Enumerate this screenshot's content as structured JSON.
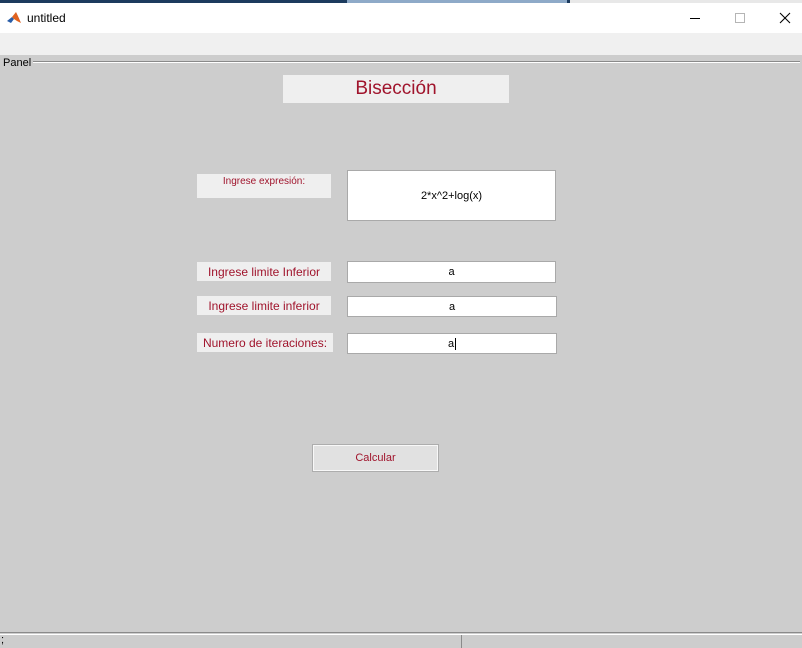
{
  "window": {
    "title": "untitled",
    "icon": "matlab-logo-icon",
    "controls": [
      "minimize-icon",
      "maximize-icon",
      "close-icon"
    ]
  },
  "panel": {
    "label": "Panel"
  },
  "form": {
    "heading": "Bisección",
    "expression_label": "Ingrese expresión:",
    "expression_value": "2*x^2+log(x)",
    "lower_label": "Ingrese limite Inferior",
    "lower_value": "a",
    "upper_label": "Ingrese limite inferior",
    "upper_value": "a",
    "iterations_label": "Numero de iteraciones:",
    "iterations_value": "a",
    "calculate_label": "Calcular"
  },
  "statusbar": {
    "text": ";"
  },
  "colors": {
    "accent_text": "#a0142c",
    "background": "#cdcdcd",
    "label_background": "#efefef"
  }
}
